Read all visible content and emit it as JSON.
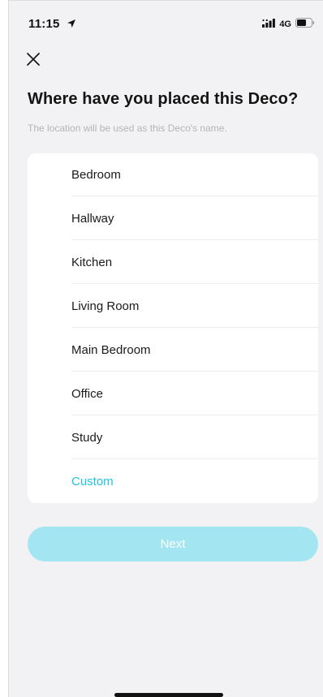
{
  "status_bar": {
    "time": "11:15",
    "network": "4G",
    "location_icon": "location-arrow-icon",
    "signal_icon": "signal-bars-icon",
    "battery_icon": "battery-icon"
  },
  "header": {
    "close_icon": "close-icon",
    "title": "Where have you placed this Deco?",
    "subtitle": "The location will be used as this Deco's name."
  },
  "locations": [
    {
      "label": "Bedroom"
    },
    {
      "label": "Hallway"
    },
    {
      "label": "Kitchen"
    },
    {
      "label": "Living Room"
    },
    {
      "label": "Main Bedroom"
    },
    {
      "label": "Office"
    },
    {
      "label": "Study"
    },
    {
      "label": "Custom"
    }
  ],
  "footer": {
    "next_label": "Next"
  },
  "colors": {
    "accent": "#22c4e3",
    "button_disabled": "#a3e6f1",
    "background": "#f2f2f4"
  }
}
